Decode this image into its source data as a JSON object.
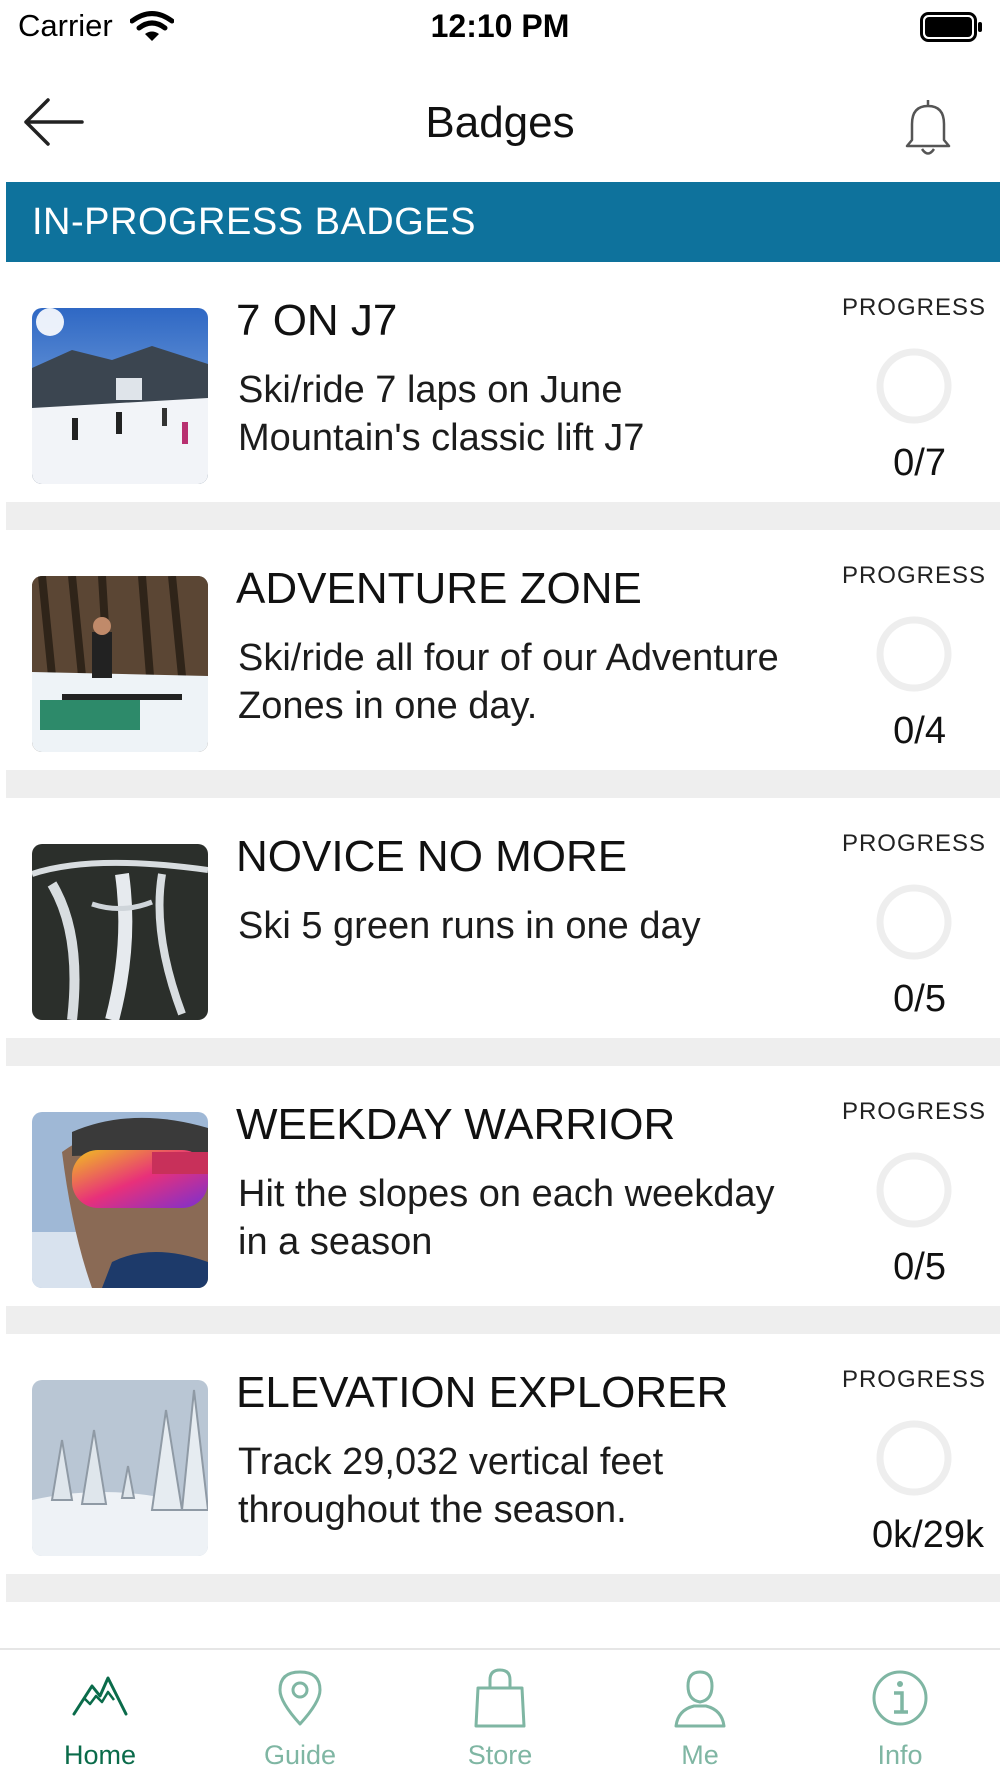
{
  "status_bar": {
    "carrier": "Carrier",
    "time": "12:10 PM"
  },
  "header": {
    "title": "Badges"
  },
  "section": {
    "title": "IN-PROGRESS BADGES"
  },
  "badges": [
    {
      "name": "7 ON J7",
      "description": "Ski/ride 7 laps on June Mountain's classic lift J7",
      "progress_label": "PROGRESS",
      "progress_value": "0/7",
      "progress_fraction": 0
    },
    {
      "name": "ADVENTURE ZONE",
      "description": "Ski/ride all four of our Adventure Zones in one day.",
      "progress_label": "PROGRESS",
      "progress_value": "0/4",
      "progress_fraction": 0
    },
    {
      "name": "NOVICE NO MORE",
      "description": "Ski 5 green runs in one day",
      "progress_label": "PROGRESS",
      "progress_value": "0/5",
      "progress_fraction": 0
    },
    {
      "name": "WEEKDAY WARRIOR",
      "description": "Hit the slopes on each weekday in a season",
      "progress_label": "PROGRESS",
      "progress_value": "0/5",
      "progress_fraction": 0
    },
    {
      "name": "ELEVATION EXPLORER",
      "description": "Track 29,032 vertical feet throughout the season.",
      "progress_label": "PROGRESS",
      "progress_value": "0k/29k",
      "progress_fraction": 0
    }
  ],
  "tab_bar": {
    "active": "Home",
    "tabs": [
      {
        "label": "Home",
        "icon": "mountain-icon"
      },
      {
        "label": "Guide",
        "icon": "map-pin-icon"
      },
      {
        "label": "Store",
        "icon": "shopping-bag-icon"
      },
      {
        "label": "Me",
        "icon": "person-icon"
      },
      {
        "label": "Info",
        "icon": "info-icon"
      }
    ]
  },
  "colors": {
    "section_header": "#0e729c",
    "tab_active": "#0a6b4a",
    "tab_inactive": "#7fb6a3",
    "ring": "#eeeeee"
  }
}
